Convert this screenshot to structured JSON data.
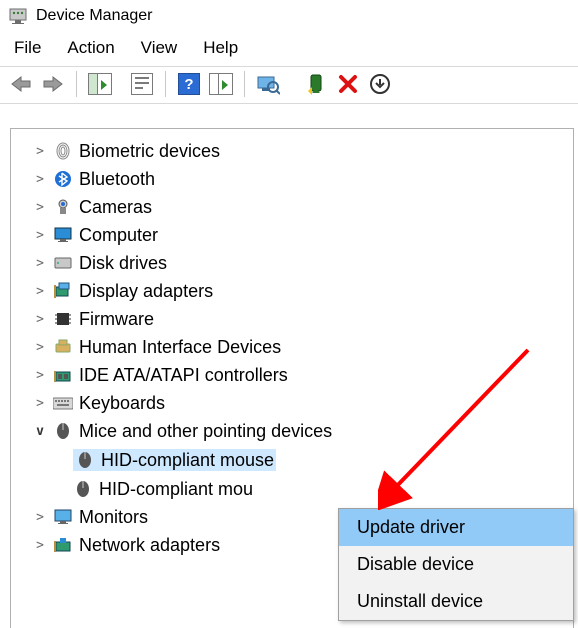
{
  "title": "Device Manager",
  "menus": [
    "File",
    "Action",
    "View",
    "Help"
  ],
  "tree": [
    {
      "label": "Biometric devices",
      "icon": "fingerprint",
      "expanded": false
    },
    {
      "label": "Bluetooth",
      "icon": "bluetooth",
      "expanded": false
    },
    {
      "label": "Cameras",
      "icon": "camera",
      "expanded": false
    },
    {
      "label": "Computer",
      "icon": "monitor",
      "expanded": false
    },
    {
      "label": "Disk drives",
      "icon": "disk",
      "expanded": false
    },
    {
      "label": "Display adapters",
      "icon": "display",
      "expanded": false
    },
    {
      "label": "Firmware",
      "icon": "chip",
      "expanded": false
    },
    {
      "label": "Human Interface Devices",
      "icon": "hid",
      "expanded": false
    },
    {
      "label": "IDE ATA/ATAPI controllers",
      "icon": "ide",
      "expanded": false
    },
    {
      "label": "Keyboards",
      "icon": "keyboard",
      "expanded": false
    },
    {
      "label": "Mice and other pointing devices",
      "icon": "mouse",
      "expanded": true,
      "children": [
        {
          "label": "HID-compliant mouse",
          "icon": "mouse",
          "selected": true
        },
        {
          "label": "HID-compliant mou",
          "icon": "mouse",
          "selected": false
        }
      ]
    },
    {
      "label": "Monitors",
      "icon": "monitor2",
      "expanded": false
    },
    {
      "label": "Network adapters",
      "icon": "network",
      "expanded": false
    }
  ],
  "context_menu": {
    "items": [
      "Update driver",
      "Disable device",
      "Uninstall device"
    ],
    "highlight_index": 0
  }
}
